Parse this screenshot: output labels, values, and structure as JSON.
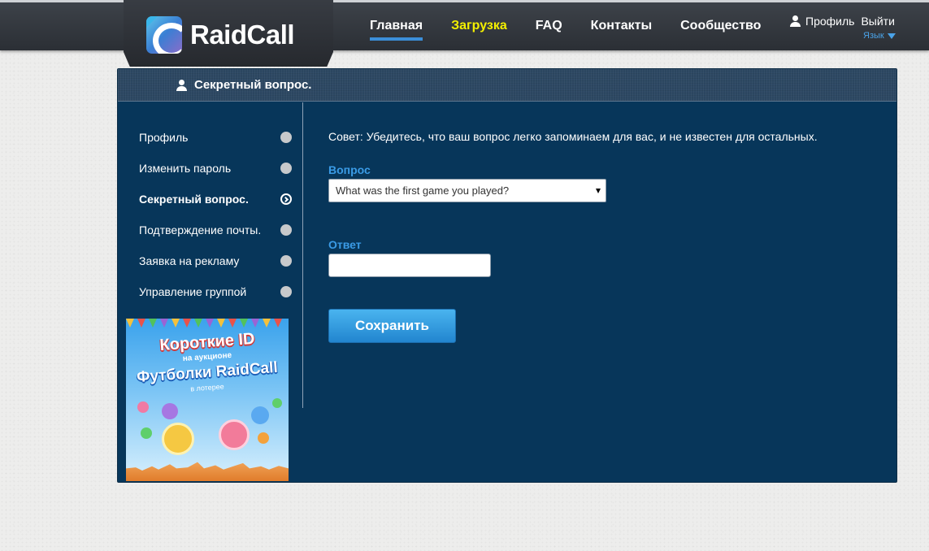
{
  "header": {
    "logo_text": "RaidCall",
    "nav": [
      {
        "label": "Главная"
      },
      {
        "label": "Загрузка"
      },
      {
        "label": "FAQ"
      },
      {
        "label": "Контакты"
      },
      {
        "label": "Сообщество"
      }
    ],
    "profile_label": "Профиль",
    "logout_label": "Выйти",
    "language_label": "Язык"
  },
  "panel": {
    "title": "Секретный вопрос."
  },
  "sidebar": {
    "items": [
      {
        "label": "Профиль"
      },
      {
        "label": "Изменить пароль"
      },
      {
        "label": "Секретный вопрос."
      },
      {
        "label": "Подтверждение почты."
      },
      {
        "label": "Заявка на рекламу"
      },
      {
        "label": "Управление группой"
      }
    ]
  },
  "banner": {
    "line1": "Короткие ID",
    "line1_sub": "на аукционе",
    "line2": "Футболки RaidCall",
    "line2_sub": "в лотерее"
  },
  "form": {
    "tip": "Совет: Убедитесь, что ваш вопрос легко запоминаем для вас, и не известен для остальных.",
    "question_label": "Вопрос",
    "question_value": "What was the first game you played?",
    "answer_label": "Ответ",
    "answer_value": "",
    "save_label": "Сохранить"
  }
}
